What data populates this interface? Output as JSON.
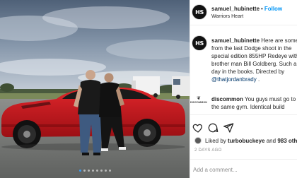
{
  "post": {
    "photo_alt": "",
    "carousel": {
      "total": 8,
      "active_index": 0
    }
  },
  "header": {
    "avatar_text": "HS",
    "username": "samuel_hubinette",
    "separator": "•",
    "follow_label": "Follow",
    "subtitle": "Warriors Heart"
  },
  "caption": {
    "avatar_text": "HS",
    "username": "samuel_hubinette",
    "line1_text": "Here are some E",
    "line2": "from the last Dodge shoot in the",
    "line3": "special edition 855HP Redeye with",
    "line4": "brother man Bill Goldberg. Such a l",
    "line5": "day in the books. Directed by",
    "line6_mention": "@thatjordanbrady",
    "line6_tail": " ."
  },
  "comments": [
    {
      "avatar_label": "DISCOMMON",
      "username": "discommon",
      "line1_text": "You guys must go to",
      "line2": "the same gym. Identical build"
    }
  ],
  "actions": {
    "icons": [
      "heart-icon",
      "comment-icon",
      "share-icon"
    ]
  },
  "likes": {
    "prefix": "Liked by ",
    "user": "turbobuckeye",
    "mid": " and ",
    "others": "983 others"
  },
  "time_ago": "2 DAYS AGO",
  "comment_input": {
    "placeholder": "Add a comment..."
  },
  "colors": {
    "accent": "#0095f6",
    "mention": "#00376b",
    "car": "#c8161c"
  }
}
